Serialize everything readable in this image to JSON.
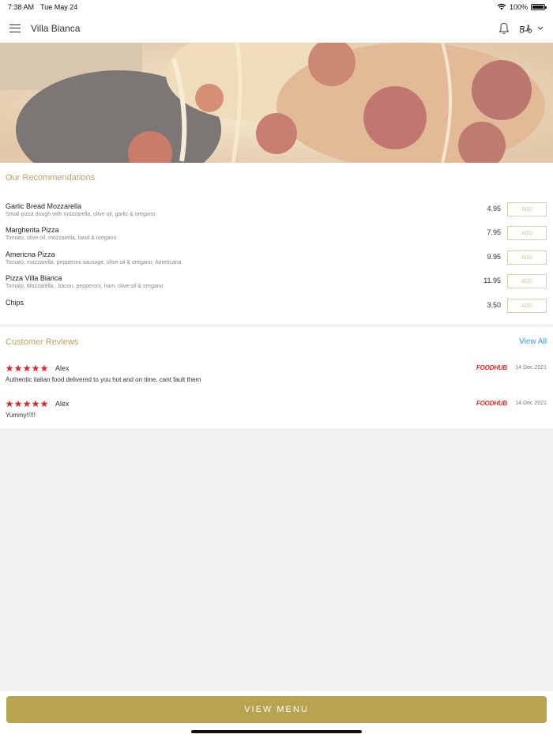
{
  "status_bar": {
    "time": "7:38 AM",
    "date": "Tue May 24",
    "battery": "100%",
    "battery_level": 1.0
  },
  "header": {
    "title": "Villa Bianca",
    "menu_icon": "hamburger-menu-icon",
    "bell_icon": "bell-icon",
    "delivery_icon": "scooter-icon",
    "chevron_icon": "chevron-down-icon"
  },
  "hero": {
    "image": "pizza-slice-photo"
  },
  "recommendations": {
    "title": "Our Recommendations",
    "add_label": "ADD",
    "items": [
      {
        "name": "Garlic Bread Mozzarella",
        "description": "Small pizza dough with mozzarella, olive oil, garlic & oregano",
        "price": "4.95"
      },
      {
        "name": "Margherita Pizza",
        "description": "Tomato, olive oil, mozzarella, basil & oregano",
        "price": "7.95"
      },
      {
        "name": "Americna Pizza",
        "description": "Tomato, mozzarella, pepperoni sausage, olive oil & oregano. Americana",
        "price": "9.95"
      },
      {
        "name": "Pizza Villa Blanca",
        "description": "Tomato, Mozzarella , bacon, pepperoni, ham, olive oil & oregano",
        "price": "11.95"
      },
      {
        "name": "Chips",
        "description": "",
        "price": "3.50"
      }
    ]
  },
  "reviews": {
    "title": "Customer Reviews",
    "view_all": "View All",
    "items": [
      {
        "rating": 5,
        "name": "Alex",
        "text": "Authentic italian food delivered to you hot and on time. cant fault them",
        "source": "FOODHUB",
        "date": "14 Dec 2021"
      },
      {
        "rating": 5,
        "name": "Alex",
        "text": "Yummy!!!!!",
        "source": "FOODHUB",
        "date": "14 Dec 2021"
      }
    ]
  },
  "footer": {
    "view_menu": "VIEW MENU"
  },
  "colors": {
    "accent_gold": "#b7a350",
    "link_blue": "#3a9bd5",
    "star_red": "#d92b2b",
    "foodhub_red": "#d92b2b"
  }
}
